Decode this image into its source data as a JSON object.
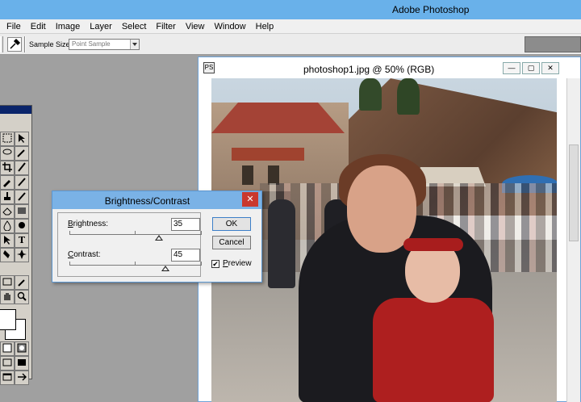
{
  "app": {
    "title": "Adobe Photoshop"
  },
  "menu": [
    "File",
    "Edit",
    "Image",
    "Layer",
    "Select",
    "Filter",
    "View",
    "Window",
    "Help"
  ],
  "options": {
    "tool_icon": "eyedropper-icon",
    "sample_label": "Sample Size:",
    "sample_value": "Point Sample"
  },
  "document": {
    "title": "photoshop1.jpg @ 50% (RGB)",
    "doc_icon": "PS",
    "btn_min": "—",
    "btn_max": "▢",
    "btn_close": "✕"
  },
  "dialog": {
    "title": "Brightness/Contrast",
    "close": "✕",
    "brightness": {
      "label_key": "B",
      "label_rest": "rightness:",
      "value": "35",
      "level": 35,
      "min": -100,
      "max": 100
    },
    "contrast": {
      "label_key": "C",
      "label_rest": "ontrast:",
      "value": "45",
      "level": 45,
      "min": -100,
      "max": 100
    },
    "ok": "OK",
    "cancel": "Cancel",
    "preview": {
      "label_key": "P",
      "label_rest": "review",
      "checked": true,
      "mark": "✔"
    }
  },
  "toolbox": {
    "tools": [
      "marquee-icon",
      "move-icon",
      "lasso-icon",
      "magic-wand-icon",
      "crop-icon",
      "slice-icon",
      "healing-brush-icon",
      "brush-icon",
      "clone-stamp-icon",
      "history-brush-icon",
      "eraser-icon",
      "gradient-icon",
      "blur-icon",
      "dodge-icon",
      "path-select-icon",
      "type-icon",
      "pen-icon",
      "shape-icon",
      "notes-icon",
      "eyedropper-icon",
      "hand-icon",
      "zoom-icon"
    ],
    "type_glyph": "T"
  }
}
